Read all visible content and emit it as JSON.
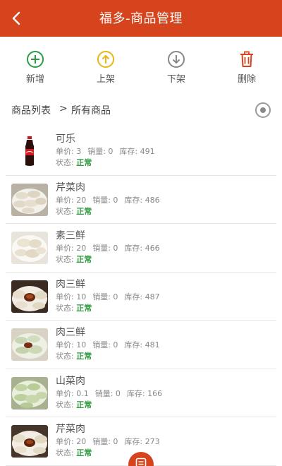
{
  "header": {
    "title": "福多-商品管理"
  },
  "toolbar": {
    "add_label": "新增",
    "list_label": "上架",
    "delist_label": "下架",
    "delete_label": "删除"
  },
  "breadcrumb": {
    "level1": "商品列表",
    "separator": ">",
    "level2": "所有商品"
  },
  "colors": {
    "brand": "#d5441c",
    "status_ok": "#2c9a3c",
    "add": "#2e9b44",
    "list": "#e9b514",
    "delist": "#888888",
    "delete": "#d5441c"
  },
  "products": [
    {
      "name": "可乐",
      "price_label": "单价: 3",
      "sales_label": "销量: 0",
      "stock_label": "库存: 491",
      "status_prefix": "状态: ",
      "status": "正常",
      "image": "cola-bottle"
    },
    {
      "name": "芹菜肉",
      "price_label": "单价: 20",
      "sales_label": "销量: 0",
      "stock_label": "库存: 486",
      "status_prefix": "状态: ",
      "status": "正常",
      "image": "dumplings"
    },
    {
      "name": "素三鲜",
      "price_label": "单价: 20",
      "sales_label": "销量: 0",
      "stock_label": "库存: 466",
      "status_prefix": "状态: ",
      "status": "正常",
      "image": "dumplings"
    },
    {
      "name": "肉三鲜",
      "price_label": "单价: 10",
      "sales_label": "销量: 0",
      "stock_label": "库存: 487",
      "status_prefix": "状态: ",
      "status": "正常",
      "image": "dumplings-sauce"
    },
    {
      "name": "肉三鲜",
      "price_label": "单价: 10",
      "sales_label": "销量: 0",
      "stock_label": "库存: 481",
      "status_prefix": "状态: ",
      "status": "正常",
      "image": "dumplings-green"
    },
    {
      "name": "山菜肉",
      "price_label": "单价: 0.1",
      "sales_label": "销量: 0",
      "stock_label": "库存: 166",
      "status_prefix": "状态: ",
      "status": "正常",
      "image": "dumplings-green"
    },
    {
      "name": "芹菜肉",
      "price_label": "单价: 20",
      "sales_label": "销量: 0",
      "stock_label": "库存: 273",
      "status_prefix": "状态: ",
      "status": "正常",
      "image": "dumplings-sauce"
    }
  ]
}
